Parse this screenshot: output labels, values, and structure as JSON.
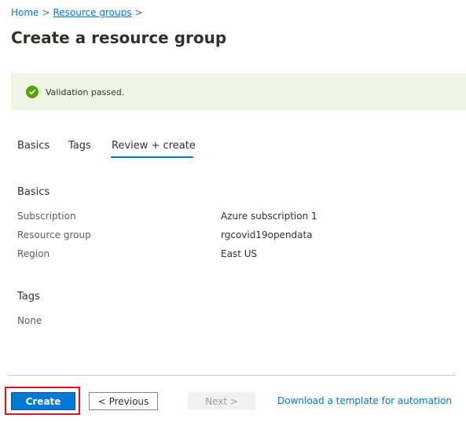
{
  "breadcrumb": {
    "home": "Home",
    "separator": ">",
    "resource_groups": "Resource groups"
  },
  "page_title": "Create a resource group",
  "banner": {
    "text": "Validation passed.",
    "icon": "checkmark-circle-icon",
    "icon_color": "#57a300",
    "background": "#eff6e6"
  },
  "tabs": {
    "basics": "Basics",
    "tags": "Tags",
    "review_create": "Review + create",
    "active": "Review + create"
  },
  "basics_section": {
    "title": "Basics",
    "rows": [
      {
        "label": "Subscription",
        "value": "Azure subscription 1"
      },
      {
        "label": "Resource group",
        "value": "rgcovid19opendata"
      },
      {
        "label": "Region",
        "value": "East US"
      }
    ]
  },
  "tags_section": {
    "title": "Tags",
    "value": "None"
  },
  "footer": {
    "create": "Create",
    "previous": "< Previous",
    "next": "Next >",
    "download_template": "Download a template for automation"
  },
  "colors": {
    "accent": "#0078d4",
    "highlight": "#e81123"
  }
}
